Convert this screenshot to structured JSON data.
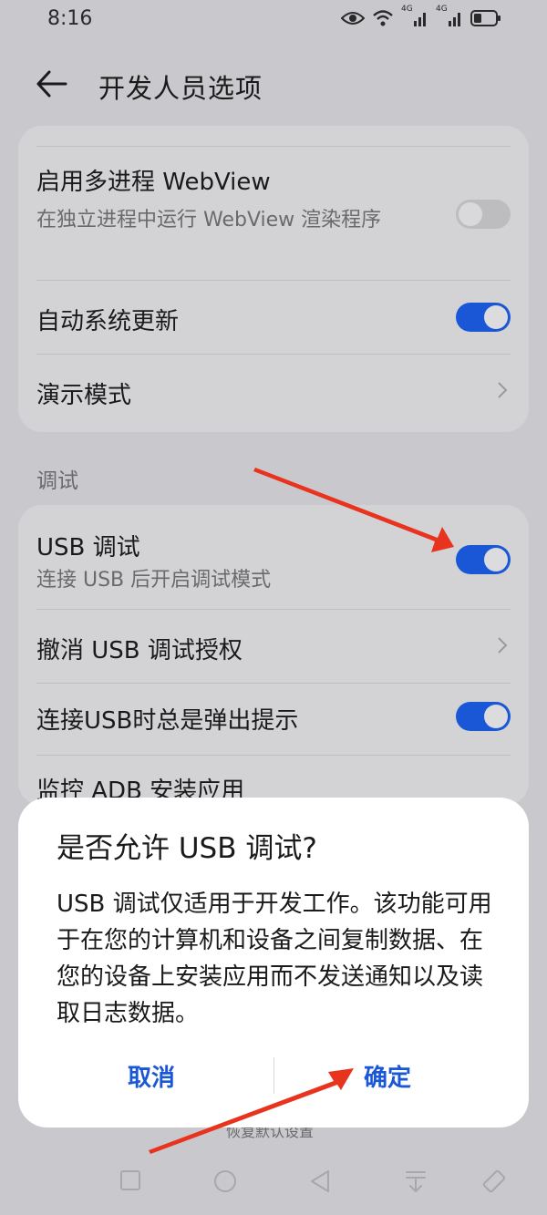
{
  "status_bar": {
    "time": "8:16",
    "signal_1": "4G",
    "signal_2": "4G",
    "icons": [
      "eye-icon",
      "wifi-icon",
      "signal-icon",
      "battery-icon"
    ]
  },
  "header": {
    "title": "开发人员选项",
    "back_icon": "arrow-left-icon"
  },
  "card1": {
    "webview_title": "启用多进程 WebView",
    "webview_desc": "在独立进程中运行 WebView 渲染程序",
    "webview_enabled": false,
    "auto_update_title": "自动系统更新",
    "auto_update_enabled": true,
    "demo_mode_title": "演示模式"
  },
  "section_label": "调试",
  "card2": {
    "usb_debug_title": "USB 调试",
    "usb_debug_desc": "连接 USB 后开启调试模式",
    "usb_debug_enabled": true,
    "revoke_title": "撤消 USB 调试授权",
    "always_prompt_title": "连接USB时总是弹出提示",
    "always_prompt_enabled": true,
    "adb_monitor_title": "监控 ADB 安装应用"
  },
  "dialog": {
    "title": "是否允许 USB 调试?",
    "body": "USB 调试仅适用于开发工作。该功能可用于在您的计算机和设备之间复制数据、在您的设备上安装应用而不发送通知以及读取日志数据。",
    "cancel_label": "取消",
    "confirm_label": "确定"
  },
  "behind_text": "恢复默认设置",
  "colors": {
    "accent": "#1a57d6",
    "annotation_arrow": "#e8331f",
    "background": "#c9c9cd",
    "card": "#d3d3d6"
  },
  "nav_bar": {
    "icons": [
      "square-icon",
      "circle-icon",
      "triangle-back-icon",
      "notification-pull-icon",
      "rotate-icon"
    ]
  }
}
